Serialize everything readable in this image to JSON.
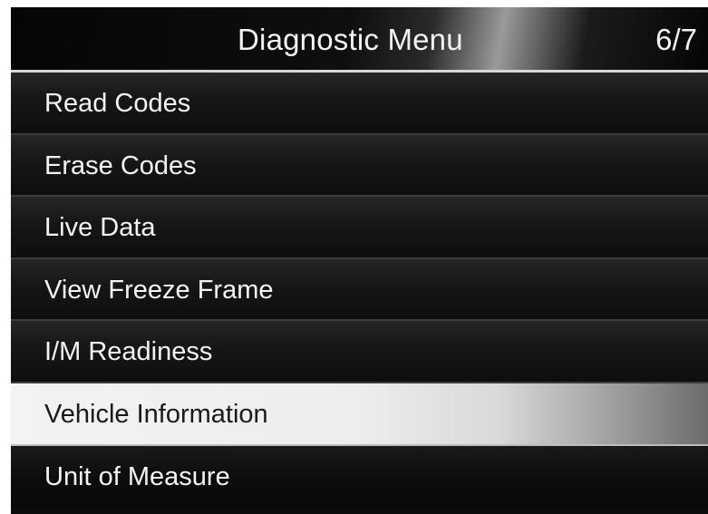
{
  "header": {
    "title": "Diagnostic Menu",
    "page_indicator": "6/7"
  },
  "menu": {
    "selected_index": 5,
    "items": [
      {
        "label": "Read Codes"
      },
      {
        "label": "Erase Codes"
      },
      {
        "label": "Live Data"
      },
      {
        "label": "View Freeze Frame"
      },
      {
        "label": "I/M Readiness"
      },
      {
        "label": "Vehicle Information"
      },
      {
        "label": "Unit of Measure"
      }
    ]
  }
}
